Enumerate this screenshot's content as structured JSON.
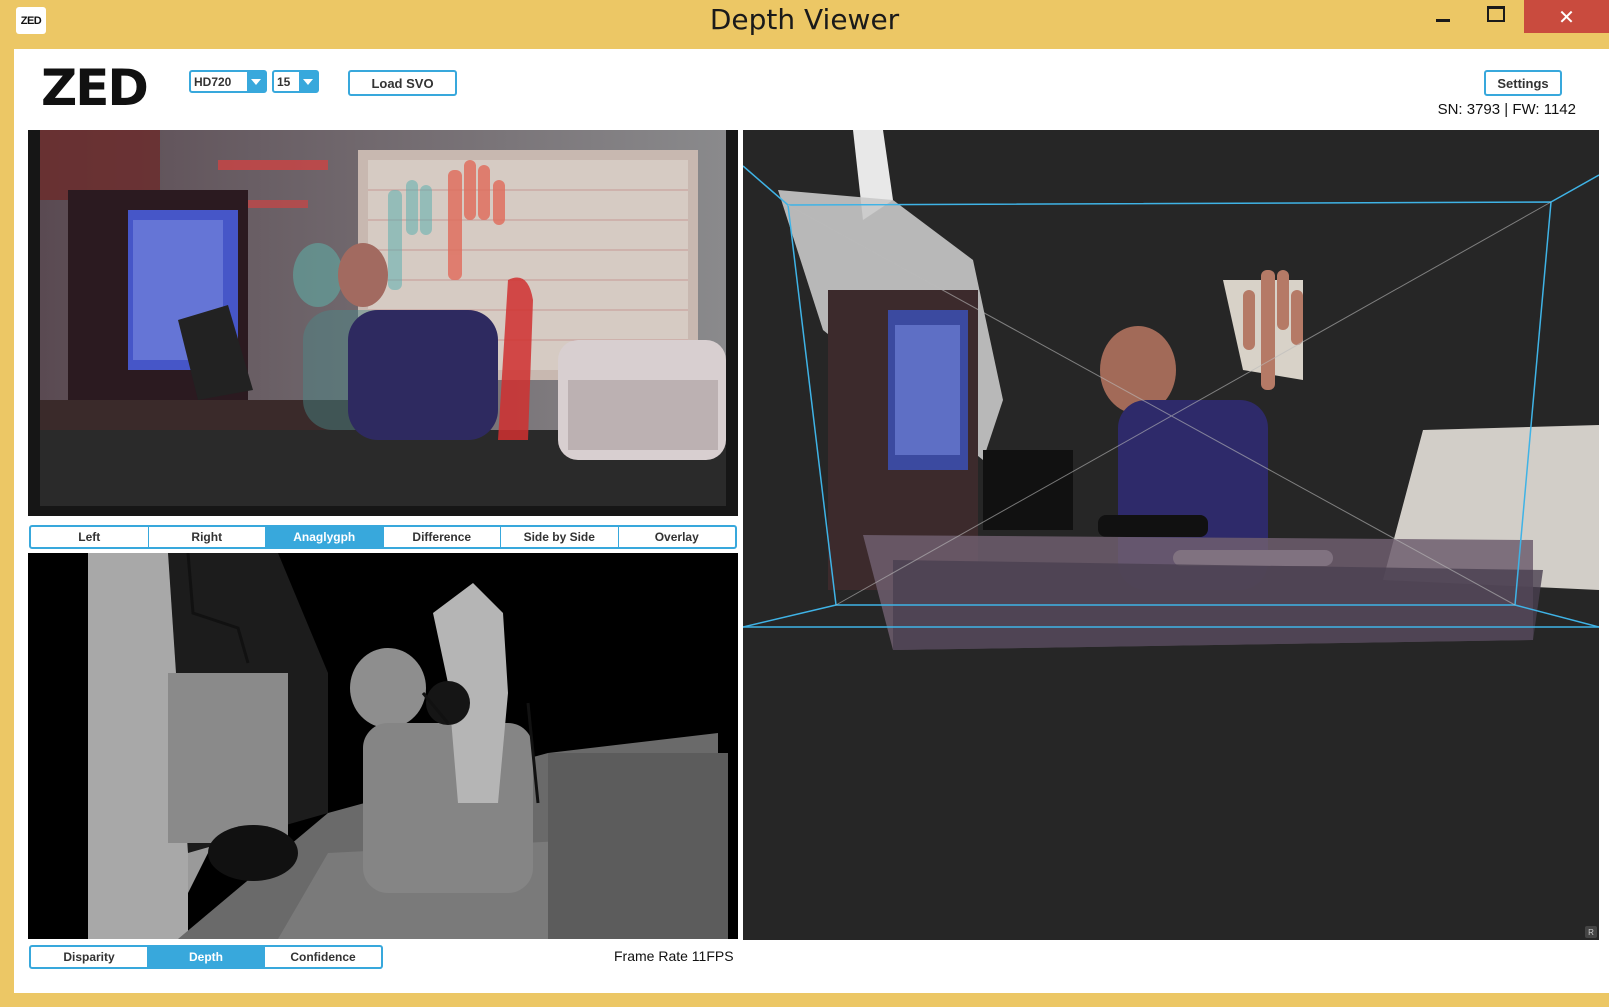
{
  "window": {
    "title": "Depth Viewer",
    "app_icon_text": "ZED",
    "close_glyph": "✕"
  },
  "toolbar": {
    "logo_text": "ZED",
    "resolution": {
      "selected": "HD720"
    },
    "fps": {
      "selected": "15"
    },
    "load_svo_label": "Load SVO",
    "settings_label": "Settings",
    "serial_info": "SN: 3793 | FW: 1142"
  },
  "view_tabs": {
    "items": [
      "Left",
      "Right",
      "Anaglygph",
      "Difference",
      "Side by Side",
      "Overlay"
    ],
    "active": "Anaglygph"
  },
  "depth_tabs": {
    "items": [
      "Disparity",
      "Depth",
      "Confidence"
    ],
    "active": "Depth"
  },
  "status": {
    "frame_rate": "Frame Rate 11FPS"
  },
  "point_cloud": {
    "corner_badge": "R"
  },
  "colors": {
    "titlebar": "#ecc765",
    "accent": "#38a8dc",
    "close": "#c94b3e"
  }
}
